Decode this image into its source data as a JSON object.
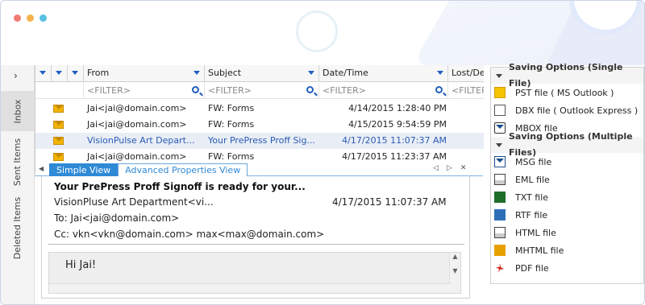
{
  "window": {
    "dot_colors": [
      "#f07b73",
      "#f4b34c",
      "#57c0e2"
    ]
  },
  "vertical_nav": {
    "expand_glyph": "›",
    "tabs": [
      {
        "label": "Inbox",
        "active": true
      },
      {
        "label": "Sent Items",
        "active": false
      },
      {
        "label": "Deleted Items",
        "active": false
      }
    ]
  },
  "grid": {
    "columns": {
      "from": "From",
      "subject": "Subject",
      "datetime": "Date/Time",
      "lost": "Lost/De"
    },
    "filter_placeholder": "<FILTER>",
    "rows": [
      {
        "from": "Jai<jai@domain.com>",
        "subject": "FW: Forms",
        "date": "4/14/2015 1:28:40 PM",
        "selected": false
      },
      {
        "from": "Jai<jai@domain.com>",
        "subject": "FW: Forms",
        "date": "4/15/2015 9:54:59 PM",
        "selected": false
      },
      {
        "from": "VisionPulse Art Depart...",
        "subject": "Your PrePress Proff Sig...",
        "date": "4/17/2015 11:07:37 AM",
        "selected": true
      },
      {
        "from": "Jai<jai@domain.com>",
        "subject": "FW: Forms",
        "date": "4/17/2015 11:23:37 AM",
        "selected": false
      }
    ]
  },
  "view_tabs": {
    "simple": "Simple View",
    "advanced": "Advanced Properties View"
  },
  "preview": {
    "title": "Your PrePress Proff Signoff is ready for your...",
    "from": "VisionPluse Art Department<vi...",
    "date": "4/17/2015 11:07:37 AM",
    "to": "To: Jai<jai@domain.com>",
    "cc": "Cc: vkn<vkn@domain.com> max<max@domain.com>",
    "body": "Hi Jai!"
  },
  "saving": {
    "single_header": "Saving Options (Single File)",
    "single": [
      {
        "label": "PST file ( MS Outlook )",
        "icon": "pst-icon"
      },
      {
        "label": "DBX file ( Outlook Express )",
        "icon": "dbx-icon"
      },
      {
        "label": "MBOX file",
        "icon": "mbox-icon"
      }
    ],
    "multi_header": "Saving Options (Multiple Files)",
    "multi": [
      {
        "label": "MSG file",
        "icon": "msg-icon"
      },
      {
        "label": "EML file",
        "icon": "eml-icon"
      },
      {
        "label": "TXT file",
        "icon": "txt-icon"
      },
      {
        "label": "RTF file",
        "icon": "rtf-icon"
      },
      {
        "label": "HTML file",
        "icon": "html-icon"
      },
      {
        "label": "MHTML file",
        "icon": "mhtml-icon"
      },
      {
        "label": "PDF file",
        "icon": "pdf-icon"
      }
    ]
  }
}
